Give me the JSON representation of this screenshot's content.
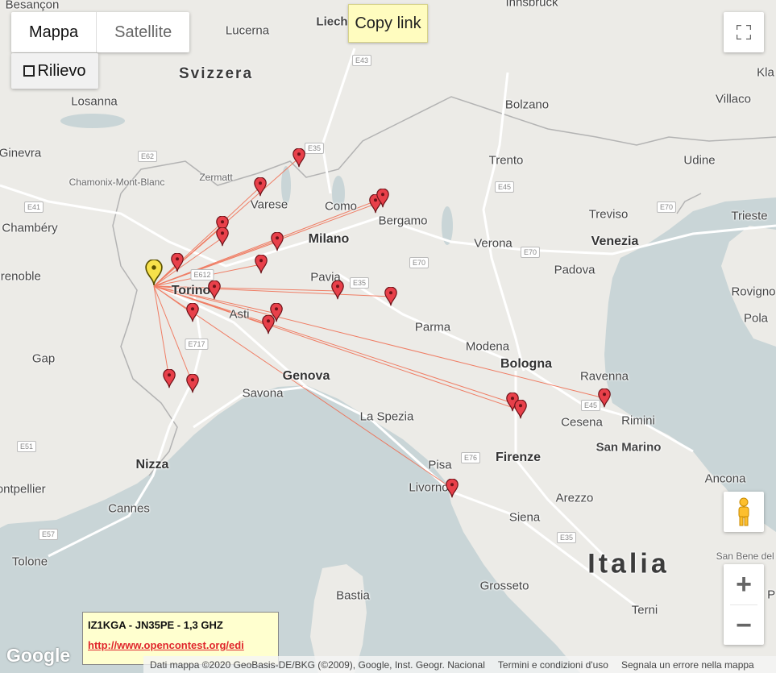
{
  "maptype": {
    "map_label": "Mappa",
    "satellite_label": "Satellite",
    "relief_label": "Rilievo"
  },
  "copy_link_label": "Copy link",
  "infobox": {
    "title": "IZ1KGA - JN35PE - 1,3 GHZ",
    "link": "http://www.opencontest.org/edi"
  },
  "google_logo": "Google",
  "attribution": {
    "data": "Dati mappa ©2020 GeoBasis-DE/BKG (©2009), Google, Inst. Geogr. Nacional",
    "terms": "Termini e condizioni d'uso",
    "report": "Segnala un errore nella mappa"
  },
  "colors": {
    "sea": "#c9d5d7",
    "land": "#ecebe7",
    "line": "#f06a4e",
    "marker": "#e8404a",
    "home_marker": "#f7e14a"
  },
  "labels": [
    {
      "text": "Besançon",
      "cls": "city"
    },
    {
      "text": "Lucerna",
      "cls": "city"
    },
    {
      "text": "Liech",
      "cls": "bold2"
    },
    {
      "text": "Innsbruck",
      "cls": "city"
    },
    {
      "text": "Svizzera",
      "cls": "country"
    },
    {
      "text": "Kla",
      "cls": "city"
    },
    {
      "text": "Losanna",
      "cls": "city"
    },
    {
      "text": "Bolzano",
      "cls": "city"
    },
    {
      "text": "Villaco",
      "cls": "city"
    },
    {
      "text": "Ginevra",
      "cls": "city"
    },
    {
      "text": "Trento",
      "cls": "city"
    },
    {
      "text": "Udine",
      "cls": "city"
    },
    {
      "text": "Chamonix-Mont-Blanc",
      "cls": "small"
    },
    {
      "text": "Zermatt",
      "cls": "small"
    },
    {
      "text": "Varese",
      "cls": "city"
    },
    {
      "text": "Como",
      "cls": "city"
    },
    {
      "text": "Bergamo",
      "cls": "city"
    },
    {
      "text": "Chambéry",
      "cls": "city"
    },
    {
      "text": "Treviso",
      "cls": "city"
    },
    {
      "text": "Trieste",
      "cls": "city"
    },
    {
      "text": "Milano",
      "cls": "big"
    },
    {
      "text": "Verona",
      "cls": "city"
    },
    {
      "text": "Venezia",
      "cls": "big"
    },
    {
      "text": "Grenoble",
      "cls": "city"
    },
    {
      "text": "Torino",
      "cls": "big"
    },
    {
      "text": "Padova",
      "cls": "city"
    },
    {
      "text": "Pavia",
      "cls": "city"
    },
    {
      "text": "Rovigno",
      "cls": "city"
    },
    {
      "text": "Asti",
      "cls": "city"
    },
    {
      "text": "Parma",
      "cls": "city"
    },
    {
      "text": "Pola",
      "cls": "city"
    },
    {
      "text": "Gap",
      "cls": "city"
    },
    {
      "text": "Modena",
      "cls": "city"
    },
    {
      "text": "Bologna",
      "cls": "big"
    },
    {
      "text": "Genova",
      "cls": "big"
    },
    {
      "text": "Ravenna",
      "cls": "city"
    },
    {
      "text": "Savona",
      "cls": "city"
    },
    {
      "text": "La Spezia",
      "cls": "city"
    },
    {
      "text": "Cesena",
      "cls": "city"
    },
    {
      "text": "Rimini",
      "cls": "city"
    },
    {
      "text": "San Marino",
      "cls": "bold2"
    },
    {
      "text": "Nizza",
      "cls": "big"
    },
    {
      "text": "Pisa",
      "cls": "city"
    },
    {
      "text": "Firenze",
      "cls": "big"
    },
    {
      "text": "Ancona",
      "cls": "city"
    },
    {
      "text": "Livorno",
      "cls": "city"
    },
    {
      "text": "Cannes",
      "cls": "city"
    },
    {
      "text": "Arezzo",
      "cls": "city"
    },
    {
      "text": "Siena",
      "cls": "city"
    },
    {
      "text": "Tolone",
      "cls": "city"
    },
    {
      "text": "Italia",
      "cls": "italia"
    },
    {
      "text": "San Bene del Tro",
      "cls": "small"
    },
    {
      "text": "Grosseto",
      "cls": "city"
    },
    {
      "text": "Bastia",
      "cls": "city"
    },
    {
      "text": "Terni",
      "cls": "city"
    },
    {
      "text": "Ascoli P",
      "cls": "city"
    },
    {
      "text": "Montpellier",
      "cls": "city"
    }
  ],
  "shields": [
    "E43",
    "E35",
    "E62",
    "E45",
    "E70",
    "E41",
    "E612",
    "E70",
    "E35",
    "E70",
    "E717",
    "E45",
    "E76",
    "E35",
    "E51",
    "E57"
  ]
}
